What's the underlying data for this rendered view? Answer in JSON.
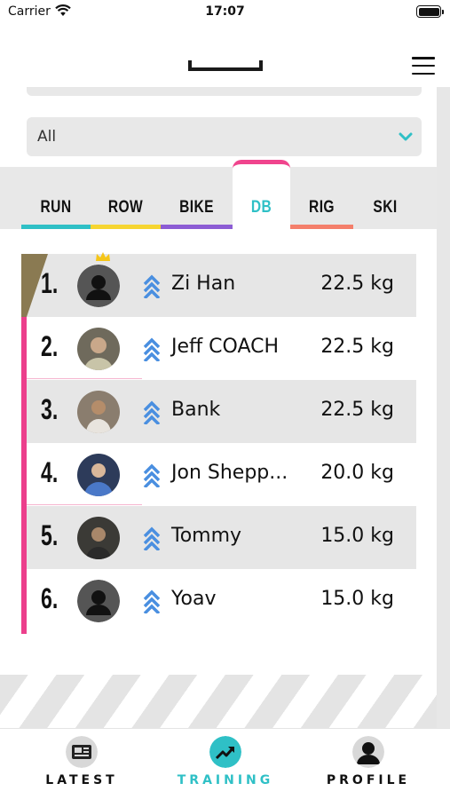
{
  "status_bar": {
    "carrier": "Carrier",
    "time": "17:07"
  },
  "filter": {
    "selected": "All"
  },
  "tabs": [
    {
      "label": "RUN",
      "color": "#2fc0c6"
    },
    {
      "label": "ROW",
      "color": "#f6d531"
    },
    {
      "label": "BIKE",
      "color": "#8c5cd4"
    },
    {
      "label": "DB",
      "color": "#2fc0c6",
      "active": true
    },
    {
      "label": "RIG",
      "color": "#f47f6b"
    },
    {
      "label": "SKI",
      "color": ""
    }
  ],
  "leaderboard": [
    {
      "rank": "1.",
      "name": "Zi Han",
      "score": "22.5 kg",
      "avatar": "default-avatar",
      "crown": true
    },
    {
      "rank": "2.",
      "name": "Jeff COACH",
      "score": "22.5 kg",
      "avatar": "photo"
    },
    {
      "rank": "3.",
      "name": "Bank",
      "score": "22.5 kg",
      "avatar": "photo"
    },
    {
      "rank": "4.",
      "name": "Jon Shepp...",
      "score": "20.0 kg",
      "avatar": "photo"
    },
    {
      "rank": "5.",
      "name": "Tommy",
      "score": "15.0 kg",
      "avatar": "photo"
    },
    {
      "rank": "6.",
      "name": "Yoav",
      "score": "15.0 kg",
      "avatar": "default-avatar"
    }
  ],
  "bottom_nav": [
    {
      "label": "LATEST",
      "icon": "news-icon"
    },
    {
      "label": "TRAINING",
      "icon": "trending-up-icon",
      "active": true
    },
    {
      "label": "PROFILE",
      "icon": "user-icon"
    }
  ],
  "colors": {
    "accent": "#2fc0c6",
    "pink": "#ec3f8c",
    "chevrons": "#4a8fe0",
    "gold": "#8a7a52"
  }
}
